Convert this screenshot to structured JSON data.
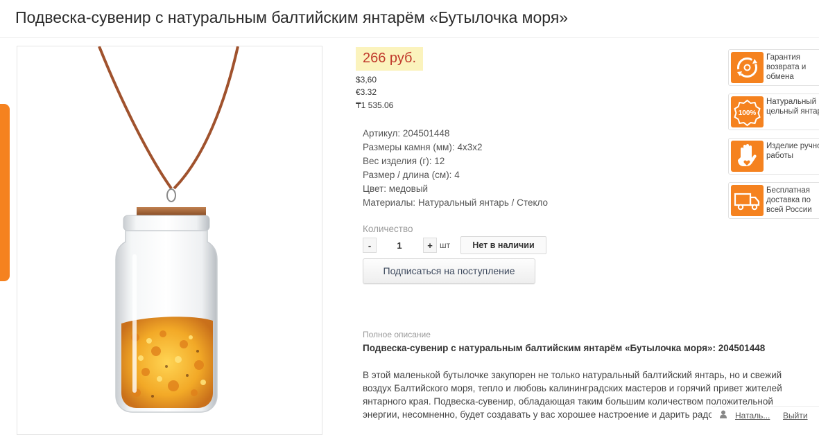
{
  "product": {
    "title": "Подвеска-сувенир с натуральным балтийским янтарём «Бутылочка моря»"
  },
  "pricing": {
    "price": "266 руб.",
    "alt_prices": [
      "$3,60",
      "€3.32",
      "₸1 535.06"
    ]
  },
  "specs": [
    {
      "label": "Артикул:",
      "value": "204501448"
    },
    {
      "label": "Размеры камня (мм):",
      "value": "4х3х2"
    },
    {
      "label": "Вес изделия (г):",
      "value": "12"
    },
    {
      "label": "Размер / длина (см):",
      "value": "4"
    },
    {
      "label": "Цвет:",
      "value": "медовый"
    },
    {
      "label": "Материалы:",
      "value": "Натуральный янтарь / Стекло"
    }
  ],
  "quantity": {
    "label": "Количество",
    "minus": "-",
    "plus": "+",
    "value": "1",
    "unit": "шт"
  },
  "stock_status": "Нет в наличии",
  "subscribe_label": "Подписаться на поступление",
  "description": {
    "label": "Полное описание",
    "heading": "Подвеска-сувенир с натуральным балтийским янтарём «Бутылочка моря»: 204501448",
    "body": "В этой маленькой бутылочке закупорен не только натуральный балтийский янтарь, но и свежий воздух Балтийского моря, тепло и любовь калининградских мастеров и горячий привет жителей янтарного края. Подвеска-сувенир, обладающая таким большим количеством положительной энергии, несомненно, будет создавать у вас хорошее настроение и дарить радость."
  },
  "badges": [
    {
      "icon": "return-arrows-icon",
      "text": "Гарантия возврата и обмена"
    },
    {
      "icon": "100-percent-seal-icon",
      "text": "Натуральный цельный янтарь"
    },
    {
      "icon": "hand-heart-icon",
      "text": "Изделие ручной работы"
    },
    {
      "icon": "delivery-truck-icon",
      "text": "Бесплатная доставка по всей России"
    }
  ],
  "footer": {
    "user_name": "Наталь...",
    "logout": "Выйти"
  },
  "colors": {
    "accent_orange": "#f5821f",
    "price_red": "#c0392b",
    "price_bg": "#fbf3bd"
  }
}
